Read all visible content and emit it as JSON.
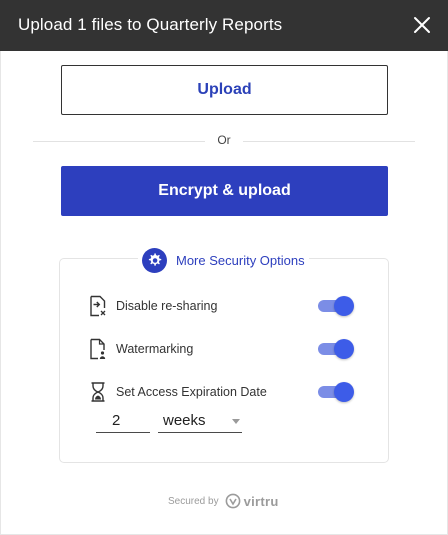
{
  "dialog": {
    "title": "Upload 1 files to Quarterly Reports",
    "close_icon": "close-icon"
  },
  "actions": {
    "upload_label": "Upload",
    "separator_label": "Or",
    "encrypt_label": "Encrypt & upload"
  },
  "security": {
    "header_label": "More Security Options",
    "header_icon": "gear-icon",
    "options": [
      {
        "label": "Disable re-sharing",
        "icon": "no-reshare-icon",
        "enabled": true
      },
      {
        "label": "Watermarking",
        "icon": "watermark-file-icon",
        "enabled": true
      },
      {
        "label": "Set Access Expiration Date",
        "icon": "hourglass-icon",
        "enabled": true
      }
    ],
    "expiration": {
      "amount": "2",
      "unit": "weeks"
    }
  },
  "footer": {
    "secured_by": "Secured by",
    "brand": "virtru"
  },
  "colors": {
    "titlebar": "#333333",
    "accent": "#2d3fbe",
    "toggle_knob": "#3d5ce8",
    "toggle_track": "#7b8de6"
  }
}
